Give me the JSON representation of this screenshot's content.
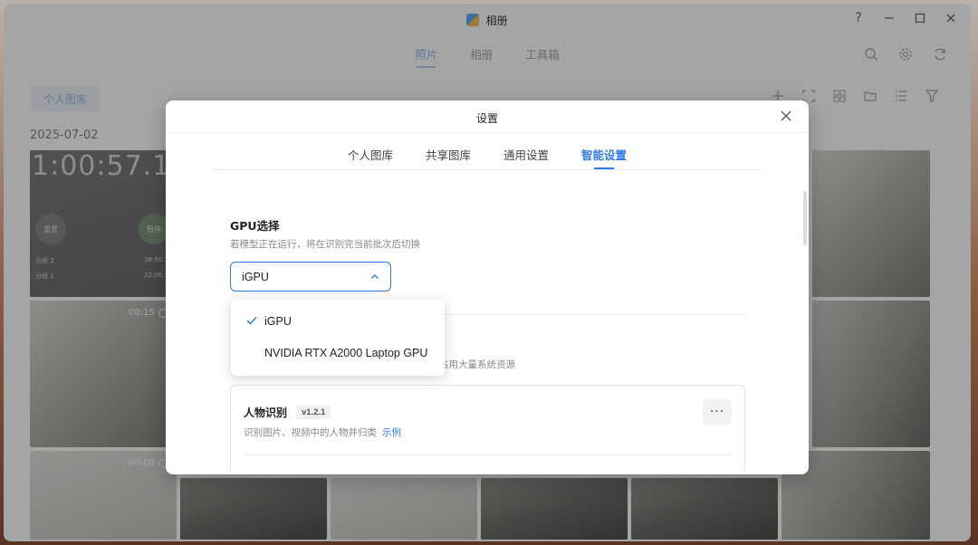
{
  "window": {
    "title": "相册",
    "controls": [
      "help",
      "minimize",
      "maximize",
      "close"
    ],
    "help_label": "?"
  },
  "top_tabs": [
    {
      "label": "照片",
      "active": true
    },
    {
      "label": "相册",
      "active": false
    },
    {
      "label": "工具箱",
      "active": false
    }
  ],
  "toolbar": {
    "library_label": "个人图库"
  },
  "timeline": {
    "date": "2025-07-02"
  },
  "photos": {
    "clock_text": "1:00:57.1",
    "circle_left": "重置",
    "circle_right": "暂停",
    "lap_rows": [
      {
        "label": "分段 2",
        "value": "38:50.7"
      },
      {
        "label": "分段 1",
        "value": "22:06.3"
      }
    ],
    "video_durations": [
      "00:15",
      "00:08"
    ]
  },
  "dialog": {
    "title": "设置",
    "tabs": [
      {
        "label": "个人图库",
        "active": false
      },
      {
        "label": "共享图库",
        "active": false
      },
      {
        "label": "通用设置",
        "active": false
      },
      {
        "label": "智能设置",
        "active": true
      }
    ],
    "gpu": {
      "title": "GPU选择",
      "hint": "若模型正在运行，将在识别完当前批次后切换",
      "selected": "iGPU",
      "options": [
        {
          "label": "iGPU",
          "checked": true
        },
        {
          "label": "NVIDIA RTX A2000 Laptop GPU",
          "checked": false
        }
      ]
    },
    "resource_hint_fragment": "占用大量系统资源",
    "face_card": {
      "title": "人物识别",
      "version": "v1.2.1",
      "description": "识别图片、视频中的人物并归类",
      "link": "示例",
      "more": "···"
    }
  },
  "colors": {
    "accent": "#2f7ae5",
    "overlay": "rgba(40,40,40,0.42)"
  }
}
